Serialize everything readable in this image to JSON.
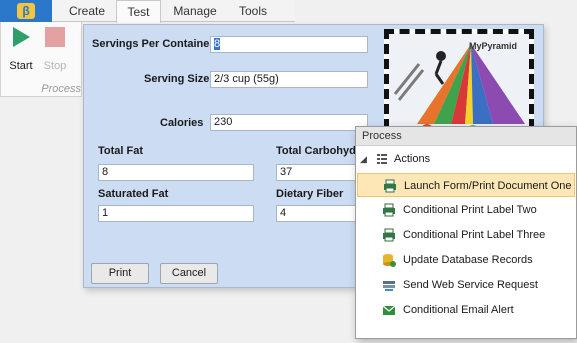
{
  "ribbon": {
    "tabs": [
      "Create",
      "Test",
      "Manage",
      "Tools"
    ],
    "active_tab": "Test",
    "start_label": "Start",
    "stop_label": "Stop",
    "group_label": "Process"
  },
  "form": {
    "servings_label": "Servings Per Container",
    "servings_value": "8",
    "serving_size_label": "Serving Size",
    "serving_size_value": "2/3 cup (55g)",
    "calories_label": "Calories",
    "calories_value": "230",
    "total_fat_label": "Total Fat",
    "total_fat_value": "8",
    "total_carb_label": "Total Carbohydr",
    "total_carb_value": "37",
    "sat_fat_label": "Saturated Fat",
    "sat_fat_value": "1",
    "fiber_label": "Dietary Fiber",
    "fiber_value": "4",
    "print_label": "Print",
    "cancel_label": "Cancel",
    "image_title": "MyPyramid"
  },
  "context_menu": {
    "header": "Process",
    "group_label": "Actions",
    "items": [
      {
        "label": "Launch Form/Print Document One",
        "icon": "printer-icon",
        "highlighted": true
      },
      {
        "label": "Conditional Print Label Two",
        "icon": "printer-icon"
      },
      {
        "label": "Conditional Print Label Three",
        "icon": "printer-icon"
      },
      {
        "label": "Update Database Records",
        "icon": "database-icon"
      },
      {
        "label": "Send Web Service Request",
        "icon": "web-service-icon"
      },
      {
        "label": "Conditional Email Alert",
        "icon": "email-icon"
      }
    ]
  },
  "colors": {
    "ribbon_accent": "#2b77c9",
    "form_background": "#cbdcf3",
    "start_green": "#2e9e6b",
    "stop_red": "#e3a1a1",
    "menu_highlight": "#fde7b6"
  }
}
